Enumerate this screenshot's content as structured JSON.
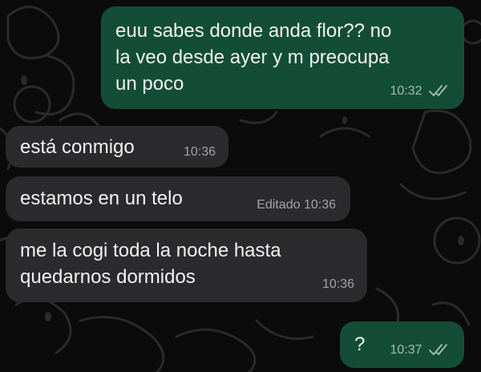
{
  "messages": [
    {
      "direction": "outgoing",
      "text": "euu sabes donde anda flor?? no\nla veo desde ayer y m preocupa\nun poco",
      "time": "10:32",
      "status": "read-double-check"
    },
    {
      "direction": "incoming",
      "text": "está conmigo",
      "time": "10:36"
    },
    {
      "direction": "incoming",
      "text": "estamos en un telo",
      "edited_label": "Editado",
      "time": "10:36"
    },
    {
      "direction": "incoming",
      "text": "me la cogi toda la noche hasta\nquedarnos dormidos",
      "time": "10:36"
    },
    {
      "direction": "outgoing",
      "text": "?",
      "time": "10:37",
      "status": "read-double-check"
    }
  ],
  "colors": {
    "outgoing_bubble": "#144d37",
    "incoming_bubble": "#2b2b2d",
    "background": "#0b0b0b"
  }
}
